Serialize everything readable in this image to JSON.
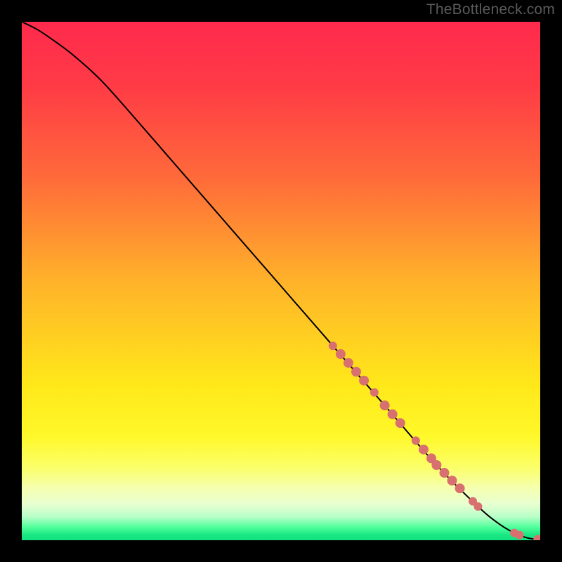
{
  "watermark": "TheBottleneck.com",
  "chart_data": {
    "type": "line",
    "title": "",
    "xlabel": "",
    "ylabel": "",
    "xlim": [
      0,
      100
    ],
    "ylim": [
      0,
      100
    ],
    "grid": false,
    "background_gradient": [
      {
        "stop": 0.0,
        "color": "#ff2a4d"
      },
      {
        "stop": 0.12,
        "color": "#ff3a46"
      },
      {
        "stop": 0.3,
        "color": "#ff6a3a"
      },
      {
        "stop": 0.5,
        "color": "#ffb22a"
      },
      {
        "stop": 0.7,
        "color": "#ffe81a"
      },
      {
        "stop": 0.8,
        "color": "#fff82a"
      },
      {
        "stop": 0.86,
        "color": "#fbff6a"
      },
      {
        "stop": 0.9,
        "color": "#f5ffb0"
      },
      {
        "stop": 0.93,
        "color": "#e8ffd0"
      },
      {
        "stop": 0.955,
        "color": "#b8ffc8"
      },
      {
        "stop": 0.975,
        "color": "#4fff9a"
      },
      {
        "stop": 0.99,
        "color": "#18e884"
      },
      {
        "stop": 1.0,
        "color": "#13e07e"
      }
    ],
    "series": [
      {
        "name": "bottleneck-curve",
        "color": "#000000",
        "x": [
          0,
          3,
          6,
          10,
          15,
          20,
          30,
          40,
          50,
          60,
          70,
          80,
          88,
          92,
          95,
          97,
          98.5,
          100
        ],
        "y": [
          100,
          98.5,
          96.5,
          93.5,
          89,
          83.5,
          72,
          60.5,
          49,
          37.5,
          26,
          14.5,
          6.5,
          3.2,
          1.4,
          0.6,
          0.25,
          0.2
        ]
      }
    ],
    "markers": {
      "name": "highlighted-points",
      "color": "#d97070",
      "points": [
        {
          "x": 60.0,
          "y": 37.5,
          "r": 6
        },
        {
          "x": 61.5,
          "y": 35.9,
          "r": 7
        },
        {
          "x": 63.0,
          "y": 34.2,
          "r": 7
        },
        {
          "x": 64.5,
          "y": 32.5,
          "r": 7
        },
        {
          "x": 66.0,
          "y": 30.8,
          "r": 7
        },
        {
          "x": 68.0,
          "y": 28.5,
          "r": 6
        },
        {
          "x": 70.0,
          "y": 26.0,
          "r": 7
        },
        {
          "x": 71.5,
          "y": 24.3,
          "r": 7
        },
        {
          "x": 73.0,
          "y": 22.6,
          "r": 7
        },
        {
          "x": 76.0,
          "y": 19.2,
          "r": 6
        },
        {
          "x": 77.5,
          "y": 17.5,
          "r": 7
        },
        {
          "x": 79.0,
          "y": 15.8,
          "r": 7
        },
        {
          "x": 80.0,
          "y": 14.5,
          "r": 7
        },
        {
          "x": 81.5,
          "y": 13.0,
          "r": 7
        },
        {
          "x": 83.0,
          "y": 11.5,
          "r": 7
        },
        {
          "x": 84.5,
          "y": 10.0,
          "r": 7
        },
        {
          "x": 87.0,
          "y": 7.5,
          "r": 6
        },
        {
          "x": 88.0,
          "y": 6.5,
          "r": 6
        },
        {
          "x": 95.0,
          "y": 1.4,
          "r": 6
        },
        {
          "x": 96.0,
          "y": 1.0,
          "r": 6
        },
        {
          "x": 99.5,
          "y": 0.2,
          "r": 6
        },
        {
          "x": 100.0,
          "y": 0.2,
          "r": 6
        }
      ]
    }
  }
}
